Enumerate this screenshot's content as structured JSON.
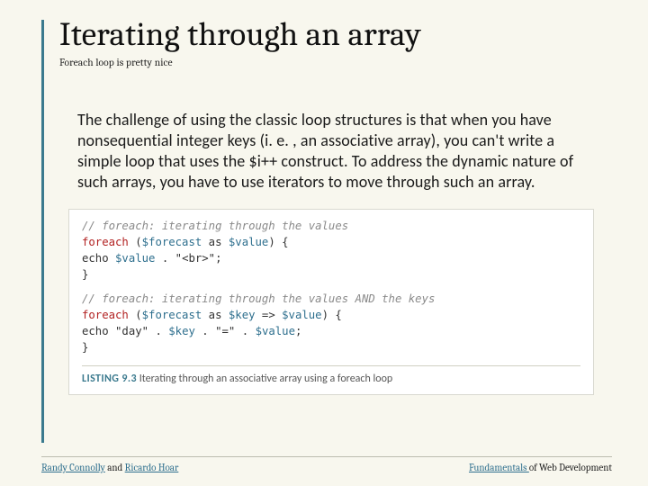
{
  "slide": {
    "title": "Iterating through an array",
    "subtitle": "Foreach loop is pretty nice",
    "body": "The challenge of using the classic loop structures is that when you have nonsequential integer keys (i. e. , an associative array), you can't write a simple loop that uses the $i++ construct. To address the dynamic nature of such arrays, you have to use iterators to move through such an array."
  },
  "code": {
    "comment1": "// foreach: iterating through the values",
    "line1_kw": "foreach",
    "line1_open": " (",
    "line1_var1": "$forecast",
    "line1_as": " as ",
    "line1_var2": "$value",
    "line1_close": ") {",
    "line2_pre": "    echo ",
    "line2_var": "$value",
    "line2_rest": " . \"<br>\";",
    "line3": "}",
    "comment2": "// foreach: iterating through the values AND the keys",
    "line4_kw": "foreach",
    "line4_open": " (",
    "line4_var1": "$forecast",
    "line4_as": " as ",
    "line4_var2": "$key",
    "line4_arrow": " => ",
    "line4_var3": "$value",
    "line4_close": ") {",
    "line5_pre": "    echo ",
    "line5_str1": "\"day\"",
    "line5_dot1": " . ",
    "line5_var1": "$key",
    "line5_dot2": " . ",
    "line5_str2": "\"=\"",
    "line5_dot3": " . ",
    "line5_var2": "$value",
    "line5_end": ";",
    "line6": "}"
  },
  "listing": {
    "tag": "LISTING 9.3",
    "caption": " Iterating through an associative array using a foreach loop"
  },
  "footer": {
    "author1": "Randy Connolly",
    "and": " and ",
    "author2": "Ricardo Hoar",
    "book_pre": "Fundamentals ",
    "book_rest": "of Web Development"
  }
}
